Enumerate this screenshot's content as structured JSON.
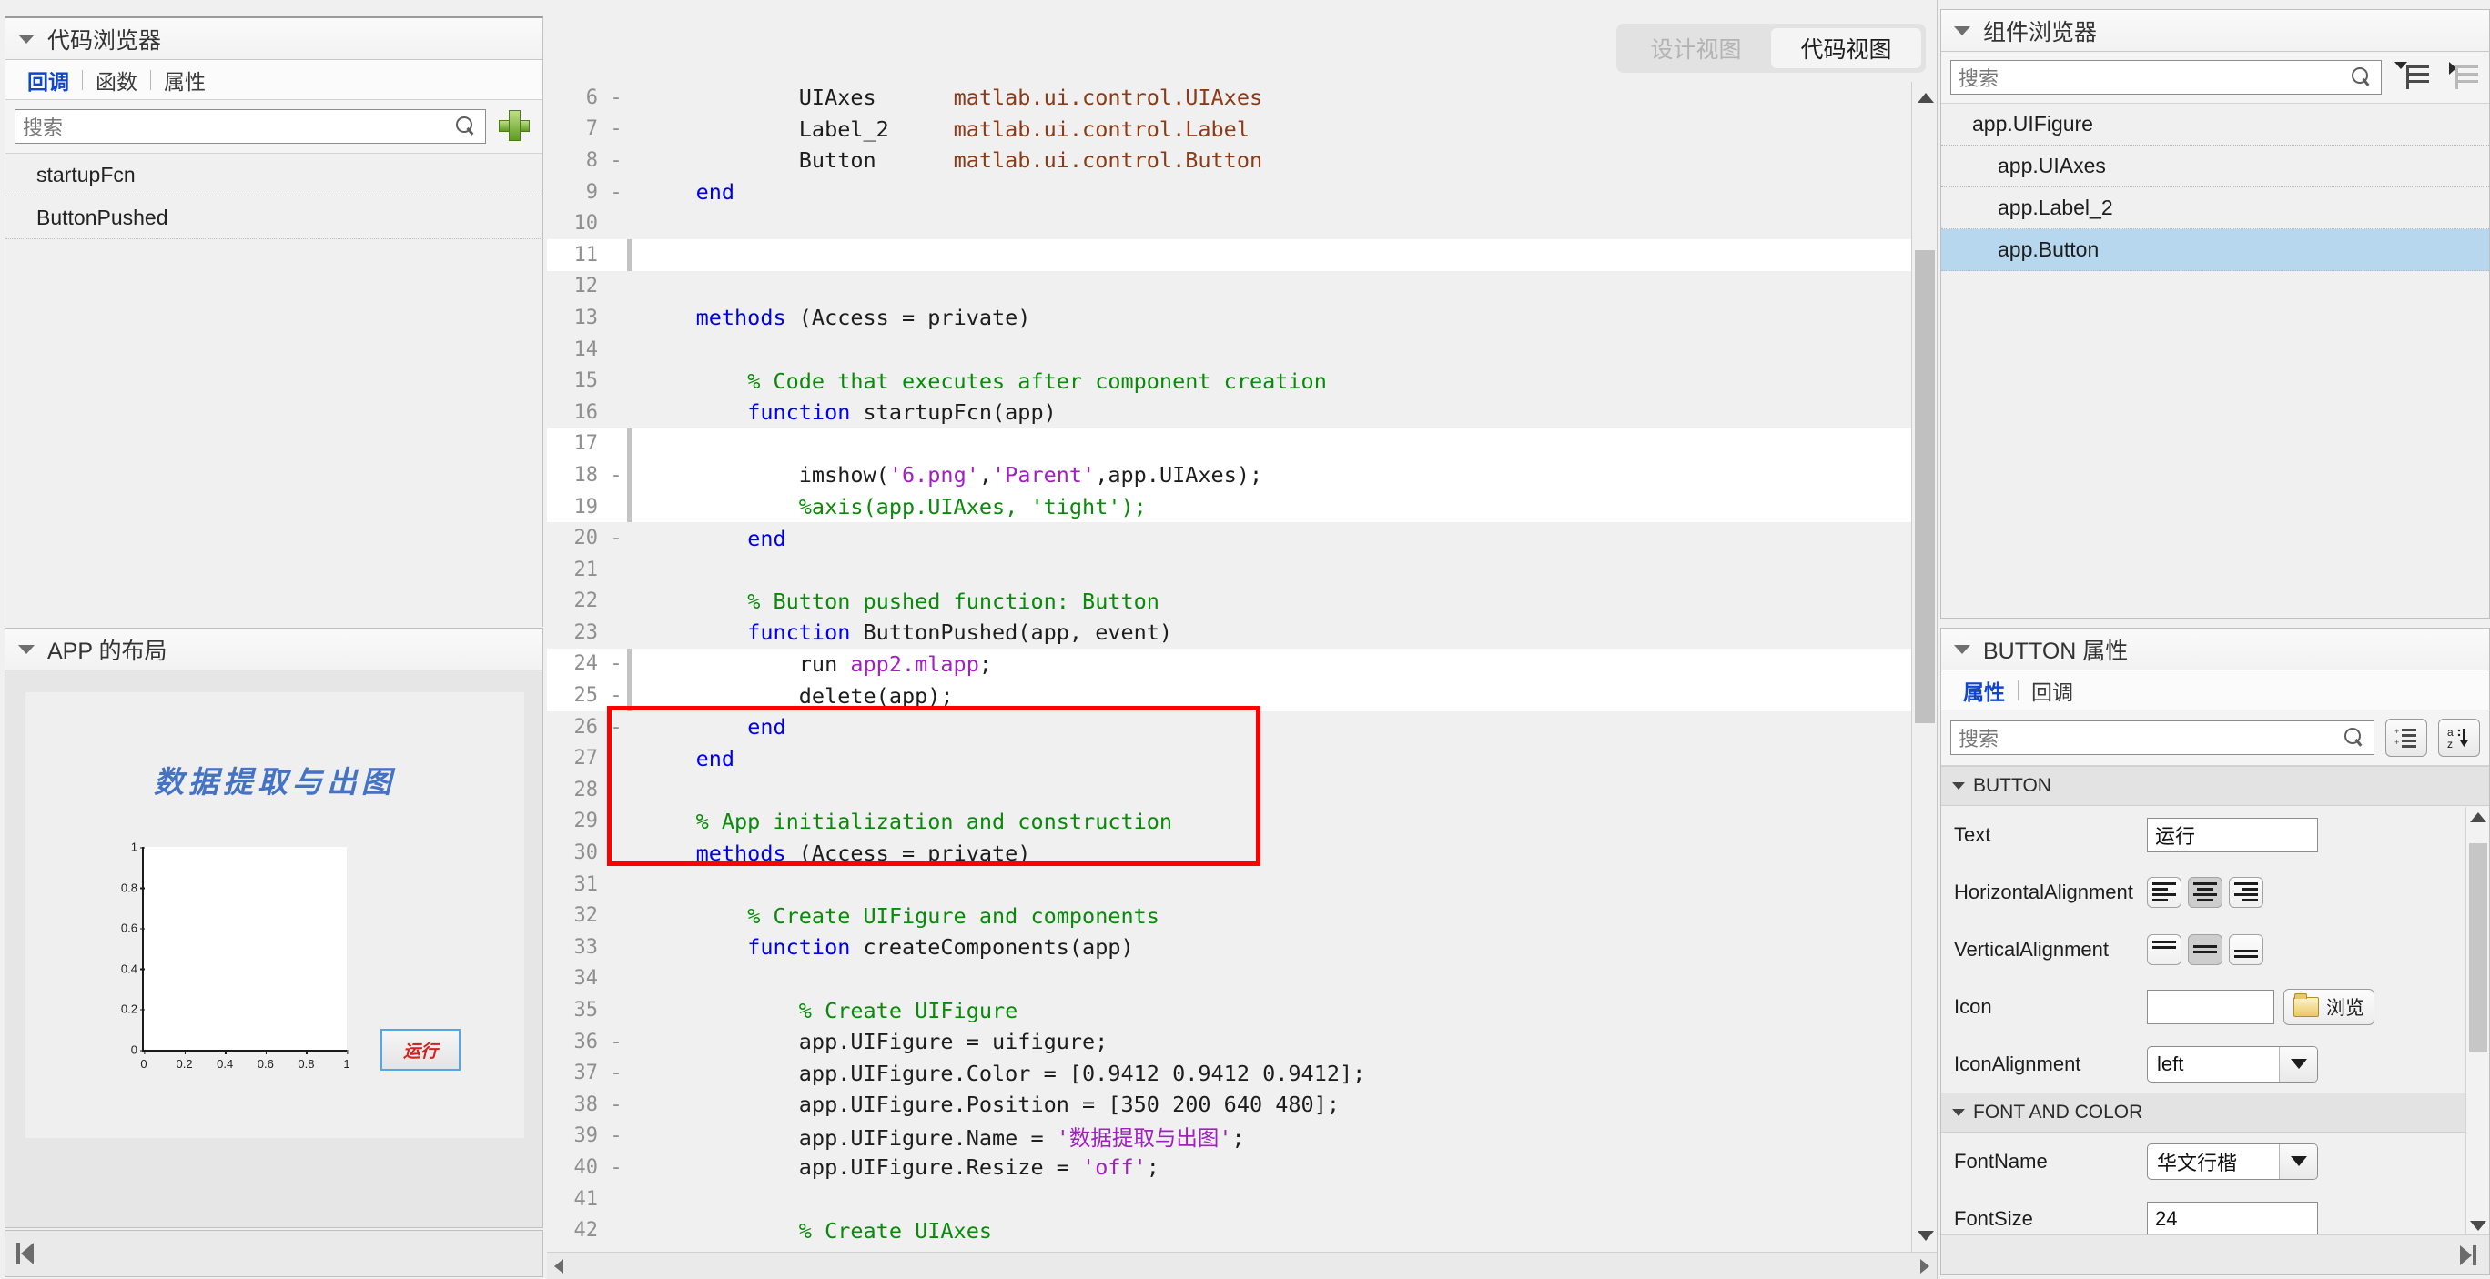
{
  "left": {
    "code_browser": {
      "title": "代码浏览器",
      "tabs": [
        {
          "label": "回调",
          "active": true
        },
        {
          "label": "函数",
          "active": false
        },
        {
          "label": "属性",
          "active": false
        }
      ],
      "search_placeholder": "搜索",
      "add_icon": "plus-icon",
      "items": [
        "startupFcn",
        "ButtonPushed"
      ]
    },
    "app_layout": {
      "title": "APP 的布局",
      "app_title_text": "数据提取与出图",
      "axes": {
        "y_ticks": [
          "1",
          "0.8",
          "0.6",
          "0.4",
          "0.2",
          "0"
        ],
        "x_ticks": [
          "0",
          "0.2",
          "0.4",
          "0.6",
          "0.8",
          "1"
        ]
      },
      "run_button_label": "运行"
    },
    "bottom_bar_icon": "go-to-first-icon"
  },
  "center": {
    "view_toggle": [
      {
        "label": "设计视图",
        "active": false
      },
      {
        "label": "代码视图",
        "active": true
      }
    ],
    "code_lines": [
      {
        "n": 6,
        "mark": "-",
        "hl": false,
        "segs": [
          {
            "t": "            UIAxes      ",
            "c": ""
          },
          {
            "t": "matlab.ui.control.UIAxes",
            "c": "typ"
          }
        ]
      },
      {
        "n": 7,
        "mark": "-",
        "hl": false,
        "segs": [
          {
            "t": "            Label_2     ",
            "c": ""
          },
          {
            "t": "matlab.ui.control.Label",
            "c": "typ"
          }
        ]
      },
      {
        "n": 8,
        "mark": "-",
        "hl": false,
        "segs": [
          {
            "t": "            Button      ",
            "c": ""
          },
          {
            "t": "matlab.ui.control.Button",
            "c": "typ"
          }
        ]
      },
      {
        "n": 9,
        "mark": "-",
        "hl": false,
        "segs": [
          {
            "t": "    ",
            "c": ""
          },
          {
            "t": "end",
            "c": "kw"
          }
        ]
      },
      {
        "n": 10,
        "mark": "",
        "hl": false,
        "segs": []
      },
      {
        "n": 11,
        "mark": "",
        "hl": true,
        "segs": []
      },
      {
        "n": 12,
        "mark": "",
        "hl": false,
        "segs": []
      },
      {
        "n": 13,
        "mark": "",
        "hl": false,
        "segs": [
          {
            "t": "    ",
            "c": ""
          },
          {
            "t": "methods",
            "c": "kw"
          },
          {
            "t": " (Access = private)",
            "c": ""
          }
        ]
      },
      {
        "n": 14,
        "mark": "",
        "hl": false,
        "segs": []
      },
      {
        "n": 15,
        "mark": "",
        "hl": false,
        "segs": [
          {
            "t": "        ",
            "c": ""
          },
          {
            "t": "% Code that executes after component creation",
            "c": "cmt"
          }
        ]
      },
      {
        "n": 16,
        "mark": "",
        "hl": false,
        "segs": [
          {
            "t": "        ",
            "c": ""
          },
          {
            "t": "function",
            "c": "kw"
          },
          {
            "t": " startupFcn(app)",
            "c": ""
          }
        ]
      },
      {
        "n": 17,
        "mark": "",
        "hl": true,
        "segs": []
      },
      {
        "n": 18,
        "mark": "-",
        "hl": true,
        "segs": [
          {
            "t": "            imshow(",
            "c": ""
          },
          {
            "t": "'6.png'",
            "c": "str"
          },
          {
            "t": ",",
            "c": ""
          },
          {
            "t": "'Parent'",
            "c": "str"
          },
          {
            "t": ",app.UIAxes);",
            "c": ""
          }
        ]
      },
      {
        "n": 19,
        "mark": "",
        "hl": true,
        "segs": [
          {
            "t": "            ",
            "c": ""
          },
          {
            "t": "%axis(app.UIAxes, 'tight');",
            "c": "cmt"
          }
        ]
      },
      {
        "n": 20,
        "mark": "-",
        "hl": false,
        "segs": [
          {
            "t": "        ",
            "c": ""
          },
          {
            "t": "end",
            "c": "kw"
          }
        ]
      },
      {
        "n": 21,
        "mark": "",
        "hl": false,
        "segs": []
      },
      {
        "n": 22,
        "mark": "",
        "hl": false,
        "segs": [
          {
            "t": "        ",
            "c": ""
          },
          {
            "t": "% Button pushed function: Button",
            "c": "cmt"
          }
        ]
      },
      {
        "n": 23,
        "mark": "",
        "hl": false,
        "segs": [
          {
            "t": "        ",
            "c": ""
          },
          {
            "t": "function",
            "c": "kw"
          },
          {
            "t": " ButtonPushed(app, event)",
            "c": ""
          }
        ]
      },
      {
        "n": 24,
        "mark": "-",
        "hl": true,
        "segs": [
          {
            "t": "            run ",
            "c": ""
          },
          {
            "t": "app2.mlapp",
            "c": "str"
          },
          {
            "t": ";",
            "c": ""
          }
        ]
      },
      {
        "n": 25,
        "mark": "-",
        "hl": true,
        "segs": [
          {
            "t": "            delete(app);",
            "c": ""
          }
        ]
      },
      {
        "n": 26,
        "mark": "-",
        "hl": false,
        "segs": [
          {
            "t": "        ",
            "c": ""
          },
          {
            "t": "end",
            "c": "kw"
          }
        ]
      },
      {
        "n": 27,
        "mark": "",
        "hl": false,
        "segs": [
          {
            "t": "    ",
            "c": ""
          },
          {
            "t": "end",
            "c": "kw"
          }
        ]
      },
      {
        "n": 28,
        "mark": "",
        "hl": false,
        "segs": []
      },
      {
        "n": 29,
        "mark": "",
        "hl": false,
        "segs": [
          {
            "t": "    ",
            "c": ""
          },
          {
            "t": "% App initialization and construction",
            "c": "cmt"
          }
        ]
      },
      {
        "n": 30,
        "mark": "",
        "hl": false,
        "segs": [
          {
            "t": "    ",
            "c": ""
          },
          {
            "t": "methods",
            "c": "kw"
          },
          {
            "t": " (Access = private)",
            "c": ""
          }
        ]
      },
      {
        "n": 31,
        "mark": "",
        "hl": false,
        "segs": []
      },
      {
        "n": 32,
        "mark": "",
        "hl": false,
        "segs": [
          {
            "t": "        ",
            "c": ""
          },
          {
            "t": "% Create UIFigure and components",
            "c": "cmt"
          }
        ]
      },
      {
        "n": 33,
        "mark": "",
        "hl": false,
        "segs": [
          {
            "t": "        ",
            "c": ""
          },
          {
            "t": "function",
            "c": "kw"
          },
          {
            "t": " createComponents(app)",
            "c": ""
          }
        ]
      },
      {
        "n": 34,
        "mark": "",
        "hl": false,
        "segs": []
      },
      {
        "n": 35,
        "mark": "",
        "hl": false,
        "segs": [
          {
            "t": "            ",
            "c": ""
          },
          {
            "t": "% Create UIFigure",
            "c": "cmt"
          }
        ]
      },
      {
        "n": 36,
        "mark": "-",
        "hl": false,
        "segs": [
          {
            "t": "            app.UIFigure = uifigure;",
            "c": ""
          }
        ]
      },
      {
        "n": 37,
        "mark": "-",
        "hl": false,
        "segs": [
          {
            "t": "            app.UIFigure.Color = [0.9412 0.9412 0.9412];",
            "c": ""
          }
        ]
      },
      {
        "n": 38,
        "mark": "-",
        "hl": false,
        "segs": [
          {
            "t": "            app.UIFigure.Position = [350 200 640 480];",
            "c": ""
          }
        ]
      },
      {
        "n": 39,
        "mark": "-",
        "hl": false,
        "segs": [
          {
            "t": "            app.UIFigure.Name = ",
            "c": ""
          },
          {
            "t": "'数据提取与出图'",
            "c": "str"
          },
          {
            "t": ";",
            "c": ""
          }
        ]
      },
      {
        "n": 40,
        "mark": "-",
        "hl": false,
        "segs": [
          {
            "t": "            app.UIFigure.Resize = ",
            "c": ""
          },
          {
            "t": "'off'",
            "c": "str"
          },
          {
            "t": ";",
            "c": ""
          }
        ]
      },
      {
        "n": 41,
        "mark": "",
        "hl": false,
        "segs": []
      },
      {
        "n": 42,
        "mark": "",
        "hl": false,
        "segs": [
          {
            "t": "            ",
            "c": ""
          },
          {
            "t": "% Create UIAxes",
            "c": "cmt"
          }
        ]
      }
    ]
  },
  "right": {
    "component_browser": {
      "title": "组件浏览器",
      "search_placeholder": "搜索",
      "tree_icons": [
        "expand-all-icon",
        "collapse-all-icon"
      ],
      "items": [
        {
          "label": "app.UIFigure",
          "indent": 0,
          "selected": false
        },
        {
          "label": "app.UIAxes",
          "indent": 1,
          "selected": false
        },
        {
          "label": "app.Label_2",
          "indent": 1,
          "selected": false
        },
        {
          "label": "app.Button",
          "indent": 1,
          "selected": true
        }
      ]
    },
    "properties": {
      "title": "BUTTON 属性",
      "tabs": [
        {
          "label": "属性",
          "active": true
        },
        {
          "label": "回调",
          "active": false
        }
      ],
      "search_placeholder": "搜索",
      "tool_icons": [
        "group-properties-icon",
        "sort-alpha-icon"
      ],
      "sections": [
        {
          "name": "BUTTON",
          "rows": [
            {
              "label": "Text",
              "type": "text",
              "value": "运行"
            },
            {
              "label": "HorizontalAlignment",
              "type": "align-h",
              "selected": 1
            },
            {
              "label": "VerticalAlignment",
              "type": "align-v",
              "selected": 1
            },
            {
              "label": "Icon",
              "type": "file",
              "value": "",
              "browse_label": "浏览"
            },
            {
              "label": "IconAlignment",
              "type": "combo",
              "value": "left"
            }
          ]
        },
        {
          "name": "FONT AND COLOR",
          "rows": [
            {
              "label": "FontName",
              "type": "combo",
              "value": "华文行楷"
            },
            {
              "label": "FontSize",
              "type": "text",
              "value": "24"
            }
          ]
        }
      ],
      "bottom_icon": "go-to-last-icon"
    }
  },
  "colors": {
    "selection_blue": "#b6d7ee",
    "active_tab_blue": "#1146c8",
    "highlight_red": "#ff0000",
    "keyword_blue": "#0000f0",
    "comment_green": "#0a8a0a",
    "string_purple": "#a020c0",
    "type_brown": "#8c3b16",
    "app_title_blue": "#4472c4",
    "run_label_red": "#d32020"
  }
}
